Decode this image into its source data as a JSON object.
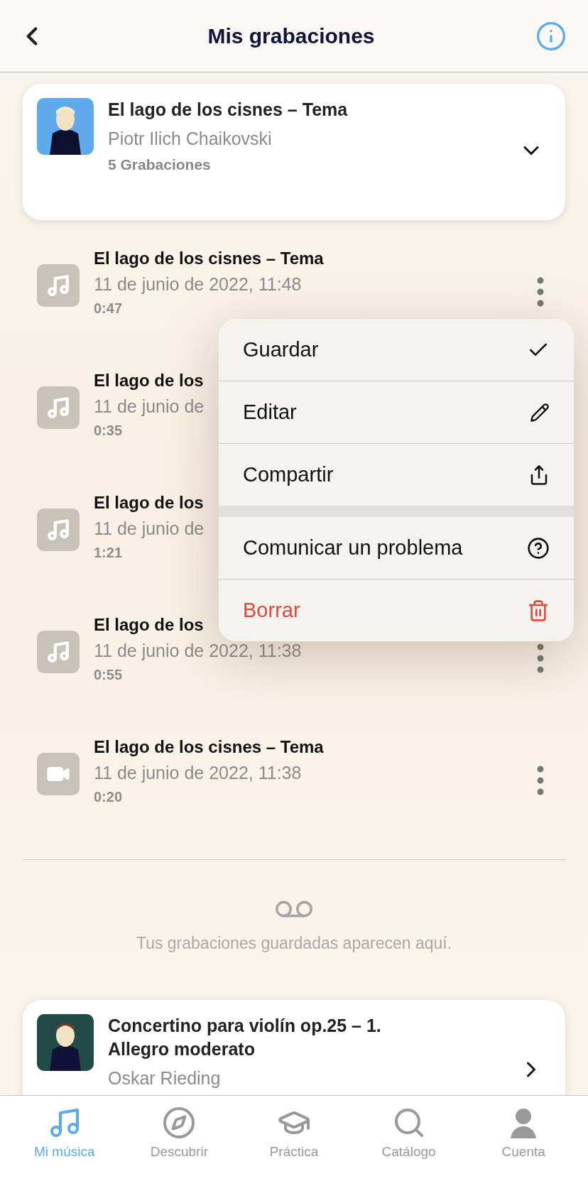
{
  "header": {
    "title": "Mis grabaciones"
  },
  "piece": {
    "title": "El lago de los cisnes – Tema",
    "composer": "Piotr Ilich Chaikovski",
    "count": "5 Grabaciones",
    "expanded": true
  },
  "recordings": [
    {
      "kind": "audio",
      "title": "El lago de los cisnes – Tema",
      "date": "11 de junio de 2022, 11:48",
      "duration": "0:47",
      "more_button": true
    },
    {
      "kind": "audio",
      "title": "El lago de los",
      "date": "11 de junio de",
      "duration": "0:35",
      "more_button": false
    },
    {
      "kind": "audio",
      "title": "El lago de los",
      "date": "11 de junio de",
      "duration": "1:21",
      "more_button": false
    },
    {
      "kind": "audio",
      "title": "El lago de los",
      "date": "11 de junio de 2022, 11:38",
      "duration": "0:55",
      "more_button": true
    },
    {
      "kind": "video",
      "title": "El lago de los cisnes – Tema",
      "date": "11 de junio de 2022, 11:38",
      "duration": "0:20",
      "more_button": true
    }
  ],
  "context_menu": {
    "sections": [
      [
        {
          "kind": "save",
          "label": "Guardar"
        },
        {
          "kind": "edit",
          "label": "Editar"
        },
        {
          "kind": "share",
          "label": "Compartir"
        }
      ],
      [
        {
          "kind": "report",
          "label": "Comunicar un problema"
        },
        {
          "kind": "delete",
          "label": "Borrar"
        }
      ]
    ]
  },
  "empty_state": {
    "message": "Tus grabaciones guardadas aparecen aquí."
  },
  "next_piece": {
    "title": "Concertino para violín op.25 – 1. Allegro moderato",
    "composer": "Oskar Rieding",
    "expanded": false
  },
  "tab_bar": [
    {
      "kind": "music",
      "label": "Mi música",
      "selected": true
    },
    {
      "kind": "discover",
      "label": "Descubrir",
      "selected": false
    },
    {
      "kind": "practice",
      "label": "Práctica",
      "selected": false
    },
    {
      "kind": "catalog",
      "label": "Catálogo",
      "selected": false
    },
    {
      "kind": "account",
      "label": "Cuenta",
      "selected": false
    }
  ]
}
